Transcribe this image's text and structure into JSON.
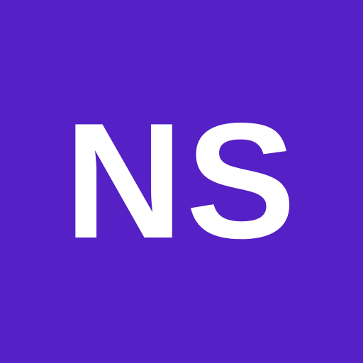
{
  "avatar": {
    "initials": "NS",
    "background_color": "#5520c5",
    "text_color": "#ffffff"
  }
}
